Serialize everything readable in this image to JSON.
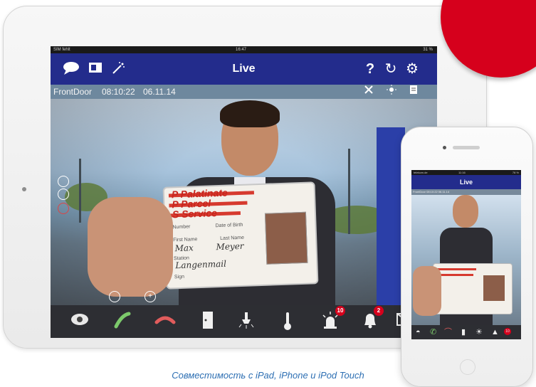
{
  "ipad": {
    "status": {
      "carrier": "SIM fehlt",
      "time": "16:47",
      "battery": "31 %"
    },
    "topbar": {
      "title": "Live",
      "left_icons": [
        "speech-bubble-icon",
        "window-icon",
        "magic-wand-icon"
      ],
      "right_icons": [
        "help-icon",
        "refresh-icon",
        "gear-icon"
      ],
      "help_glyph": "?",
      "refresh_glyph": "↻",
      "gear_glyph": "⚙"
    },
    "infobar": {
      "camera": "FrontDoor",
      "time": "08:10:22",
      "date": "06.11.14"
    },
    "id_card": {
      "brand_line1": "P Palatinate",
      "brand_line2": "P Parcel",
      "brand_line3": "S Service",
      "number_label": "Number",
      "dob_label": "Date of Birth",
      "first_name_label": "First Name",
      "last_name_label": "Last Name",
      "first_name": "Max",
      "last_name": "Meyer",
      "station_label": "Station",
      "station": "Langenmail",
      "sign_label": "Sign"
    },
    "bottom_bar": {
      "icons": [
        "camera-dome-icon",
        "phone-answer-icon",
        "phone-hangup-icon",
        "door-icon",
        "light-icon",
        "thermometer-icon",
        "alarm-light-icon",
        "bell-icon",
        "mail-icon"
      ],
      "alarm_count": "10",
      "bell_count": "2"
    }
  },
  "iphone": {
    "status": {
      "carrier": "telekom.de",
      "time": "11:16",
      "battery": "78 %"
    },
    "title": "Live",
    "infobar": "FrontDoor 08:10:22 06.11.14",
    "badge": "10"
  },
  "caption": "Совместимость с iPad, iPhone и iPod Touch"
}
